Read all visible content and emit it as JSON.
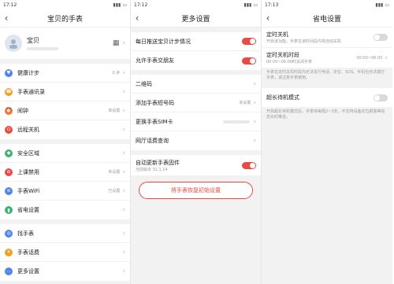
{
  "screen1": {
    "time": "17:12",
    "title": "宝贝的手表",
    "profile": {
      "name": "宝贝"
    },
    "group1": [
      {
        "label": "健康计步",
        "value": "0 步",
        "color": "#4f86e8",
        "icon": "heart-icon"
      },
      {
        "label": "手表通讯录",
        "value": "",
        "color": "#f0a020",
        "icon": "contacts-icon"
      },
      {
        "label": "闹钟",
        "value": "未设置",
        "color": "#f07a2a",
        "icon": "alarm-icon"
      },
      {
        "label": "远程关机",
        "value": "",
        "color": "#e74c3c",
        "icon": "power-icon"
      }
    ],
    "group2": [
      {
        "label": "安全区域",
        "value": "",
        "color": "#3cb371",
        "icon": "shield-icon"
      },
      {
        "label": "上课禁用",
        "value": "未设置",
        "color": "#e94a46",
        "icon": "no-class-icon"
      },
      {
        "label": "手表WiFi",
        "value": "已设置",
        "color": "#4f86e8",
        "icon": "wifi-icon"
      },
      {
        "label": "省电设置",
        "value": "",
        "color": "#3cb371",
        "icon": "battery-icon"
      }
    ],
    "group3": [
      {
        "label": "找手表",
        "value": "",
        "color": "#4f86e8",
        "icon": "locate-icon"
      },
      {
        "label": "手表话费",
        "value": "",
        "color": "#f0a020",
        "icon": "yuan-icon"
      },
      {
        "label": "更多设置",
        "value": "",
        "color": "#4f86e8",
        "icon": "more-icon"
      }
    ]
  },
  "screen2": {
    "time": "17:12",
    "title": "更多设置",
    "toggles": [
      {
        "label": "每日推送宝贝计步情况",
        "on": true
      },
      {
        "label": "允许手表交朋友",
        "on": true
      }
    ],
    "links": [
      {
        "label": "二维码",
        "value": ""
      },
      {
        "label": "添加手表短号码",
        "value": "未设置"
      },
      {
        "label": "更换手表SIM卡",
        "value": ""
      },
      {
        "label": "网厅话费查询",
        "value": ""
      }
    ],
    "autoupdate": {
      "label": "自动更新手表固件",
      "sub": "当前版本 31.1.14",
      "on": true
    },
    "reset_label": "将手表恢复初始设置"
  },
  "screen3": {
    "time": "17:13",
    "title": "省电设置",
    "shutdown": {
      "label": "定时关机",
      "sub": "开启该功能，手表在该时间段内将自动关机",
      "on": false
    },
    "period": {
      "label": "定时关机时段",
      "sub": "00:00~06:00时关闭手表",
      "value": "00:00~06:00"
    },
    "note1": "手表在定时关机时段内无法进行电话、定位、SOS、手机也无法拨打手表，请注意手表使用。",
    "standby": {
      "label": "超长待机模式",
      "on": false
    },
    "note2": "开启超长待机模式后，手表将每隔2~3天，不支持设备定位报警等信息实时推送。"
  }
}
